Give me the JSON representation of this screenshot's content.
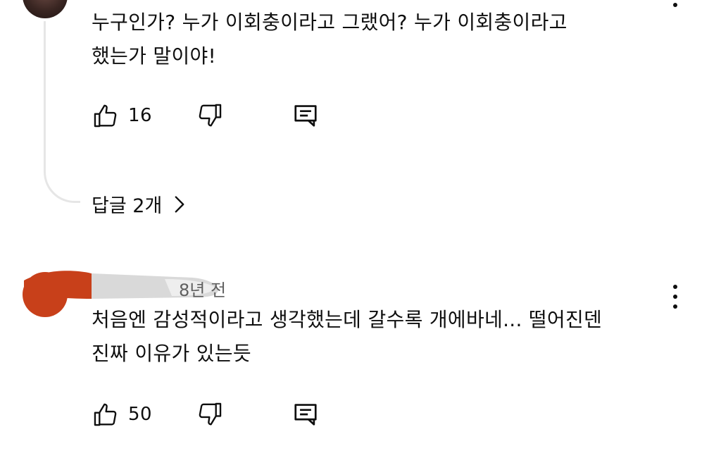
{
  "comments": [
    {
      "text": "누구인가? 누가 이회충이라고 그랬어? 누가 이회충이라고\n했는가 말이야!",
      "likes": "16",
      "replies_label": "답글 2개"
    },
    {
      "time": "8년 전",
      "text": "처음엔 감성적이라고 생각했는데 갈수록 개에바네... 떨어진덴\n진짜 이유가 있는듯",
      "likes": "50"
    }
  ],
  "icons": {
    "like": "thumb-up-icon",
    "dislike": "thumb-down-icon",
    "reply": "comment-reply-icon",
    "more": "more-vert-icon",
    "chevron": "chevron-right-icon"
  },
  "colors": {
    "text": "#0f0f0f",
    "meta": "#606060",
    "thread_line": "#e6e6e6",
    "avatar_2": "#c8401a"
  }
}
